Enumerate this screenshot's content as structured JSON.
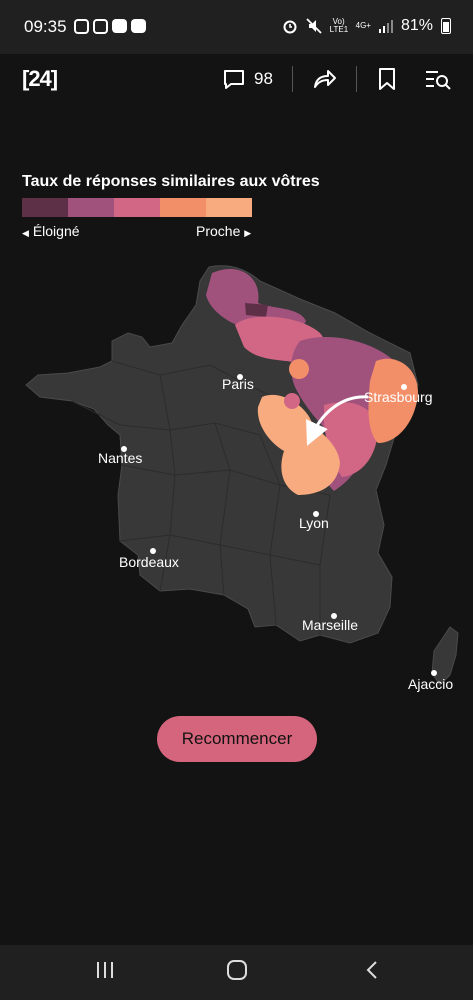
{
  "status_bar": {
    "time": "09:35",
    "volte": "Vo) LTE1",
    "network": "4G+",
    "battery": "81%"
  },
  "app_bar": {
    "logo": "[24]",
    "comment_count": "98"
  },
  "legend": {
    "title": "Taux de réponses similaires aux vôtres",
    "far_label": "Éloigné",
    "near_label": "Proche",
    "scale_colors": [
      "#5e3048",
      "#a0527d",
      "#d26785",
      "#f38f68",
      "#f8ab7e"
    ]
  },
  "map": {
    "cities": [
      {
        "name": "Paris"
      },
      {
        "name": "Strasbourg"
      },
      {
        "name": "Nantes"
      },
      {
        "name": "Lyon"
      },
      {
        "name": "Bordeaux"
      },
      {
        "name": "Marseille"
      },
      {
        "name": "Ajaccio"
      }
    ]
  },
  "restart_button": {
    "label": "Recommencer"
  }
}
